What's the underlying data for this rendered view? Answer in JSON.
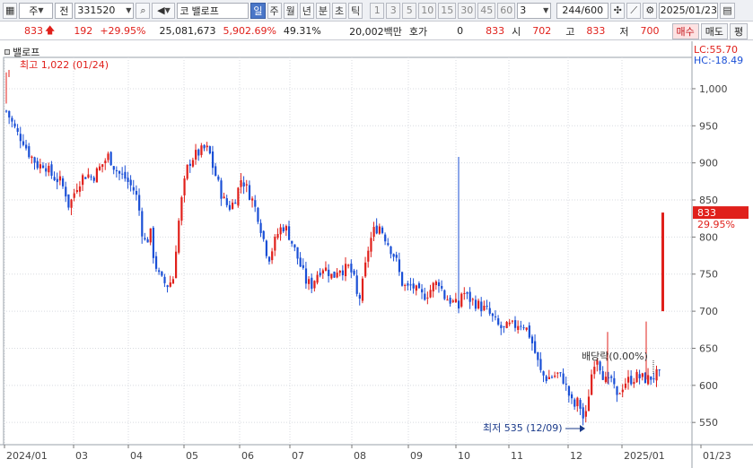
{
  "toolbar": {
    "market_label": "주",
    "type_label": "전",
    "code": "331520",
    "name": "밸로프",
    "name_prefix": "코",
    "periods": [
      "일",
      "주",
      "월",
      "년",
      "분",
      "초",
      "틱"
    ],
    "active_period": "일",
    "intervals": [
      "1",
      "3",
      "5",
      "10",
      "15",
      "30",
      "45",
      "60"
    ],
    "interval_value": "3",
    "count": "244",
    "count_total": "/600",
    "date": "2025/01/23"
  },
  "quote": {
    "price": "833",
    "change": "192",
    "change_pct": "+29.95%",
    "volume": "25,081,673",
    "volume_pct": "5,902.69%",
    "turnover_pct": "49.31%",
    "amount": "20,002백만",
    "hoga_label": "호가",
    "hoga_value": "0",
    "current": "833",
    "open_label": "시",
    "open": "702",
    "high_label": "고",
    "high": "833",
    "low_label": "저",
    "low": "700",
    "buy_label": "매수",
    "sell_label": "매도",
    "eval_label": "평"
  },
  "legend": {
    "name": "밸로프",
    "lc": "LC:55.70",
    "hc": "HC:-18.49"
  },
  "colors": {
    "up": "#e0201b",
    "down": "#1a4fd6",
    "price_tag": "#e0201b"
  },
  "chart_data": {
    "type": "candlestick",
    "ylim": [
      520,
      1035
    ],
    "yticks": [
      "1,000",
      "950",
      "900",
      "850",
      "800",
      "750",
      "700",
      "650",
      "600",
      "550"
    ],
    "ytick_values": [
      1000,
      950,
      900,
      850,
      800,
      750,
      700,
      650,
      600,
      550
    ],
    "xticks": [
      "2024/01",
      "03",
      "04",
      "05",
      "06",
      "07",
      "08",
      "09",
      "10",
      "11",
      "12",
      "2025/01",
      "01/23"
    ],
    "high_annotation": "최고 1,022 (01/24)",
    "low_annotation": "최저 535 (12/09)",
    "event_annotation": "배당락(0.00%)",
    "last_price_label": "833",
    "last_change_label": "29.95%",
    "last_price": 833,
    "path": [
      [
        0,
        1000
      ],
      [
        6,
        970
      ],
      [
        12,
        955
      ],
      [
        18,
        940
      ],
      [
        25,
        930
      ],
      [
        30,
        915
      ],
      [
        36,
        905
      ],
      [
        42,
        895
      ],
      [
        48,
        900
      ],
      [
        55,
        885
      ],
      [
        60,
        880
      ],
      [
        66,
        875
      ],
      [
        72,
        860
      ],
      [
        76,
        840
      ],
      [
        80,
        855
      ],
      [
        85,
        870
      ],
      [
        90,
        880
      ],
      [
        96,
        885
      ],
      [
        102,
        880
      ],
      [
        108,
        890
      ],
      [
        114,
        900
      ],
      [
        120,
        910
      ],
      [
        126,
        895
      ],
      [
        132,
        885
      ],
      [
        138,
        880
      ],
      [
        144,
        870
      ],
      [
        150,
        860
      ],
      [
        155,
        830
      ],
      [
        158,
        800
      ],
      [
        162,
        790
      ],
      [
        166,
        810
      ],
      [
        170,
        775
      ],
      [
        175,
        750
      ],
      [
        180,
        740
      ],
      [
        186,
        735
      ],
      [
        192,
        745
      ],
      [
        196,
        800
      ],
      [
        200,
        840
      ],
      [
        204,
        870
      ],
      [
        208,
        895
      ],
      [
        212,
        905
      ],
      [
        216,
        910
      ],
      [
        222,
        915
      ],
      [
        228,
        920
      ],
      [
        232,
        915
      ],
      [
        236,
        895
      ],
      [
        240,
        880
      ],
      [
        245,
        860
      ],
      [
        250,
        845
      ],
      [
        256,
        840
      ],
      [
        262,
        855
      ],
      [
        268,
        880
      ],
      [
        274,
        865
      ],
      [
        280,
        850
      ],
      [
        286,
        830
      ],
      [
        292,
        800
      ],
      [
        298,
        770
      ],
      [
        304,
        790
      ],
      [
        310,
        810
      ],
      [
        316,
        815
      ],
      [
        322,
        800
      ],
      [
        328,
        780
      ],
      [
        334,
        760
      ],
      [
        340,
        740
      ],
      [
        346,
        735
      ],
      [
        352,
        750
      ],
      [
        358,
        760
      ],
      [
        364,
        755
      ],
      [
        370,
        745
      ],
      [
        376,
        760
      ],
      [
        382,
        755
      ],
      [
        388,
        760
      ],
      [
        394,
        740
      ],
      [
        398,
        710
      ],
      [
        402,
        730
      ],
      [
        406,
        760
      ],
      [
        410,
        790
      ],
      [
        416,
        810
      ],
      [
        422,
        815
      ],
      [
        428,
        800
      ],
      [
        434,
        785
      ],
      [
        440,
        770
      ],
      [
        446,
        740
      ],
      [
        452,
        730
      ],
      [
        458,
        735
      ],
      [
        464,
        725
      ],
      [
        470,
        720
      ],
      [
        476,
        725
      ],
      [
        482,
        735
      ],
      [
        488,
        740
      ],
      [
        494,
        720
      ],
      [
        500,
        715
      ],
      [
        506,
        710
      ],
      [
        510,
        705
      ],
      [
        514,
        730
      ],
      [
        518,
        720
      ],
      [
        524,
        715
      ],
      [
        530,
        710
      ],
      [
        536,
        705
      ],
      [
        542,
        700
      ],
      [
        548,
        690
      ],
      [
        554,
        680
      ],
      [
        560,
        675
      ],
      [
        566,
        680
      ],
      [
        572,
        680
      ],
      [
        578,
        685
      ],
      [
        584,
        680
      ],
      [
        590,
        665
      ],
      [
        596,
        640
      ],
      [
        602,
        615
      ],
      [
        608,
        610
      ],
      [
        614,
        612
      ],
      [
        620,
        615
      ],
      [
        626,
        610
      ],
      [
        632,
        590
      ],
      [
        638,
        570
      ],
      [
        644,
        580
      ],
      [
        648,
        555
      ],
      [
        652,
        560
      ],
      [
        656,
        600
      ],
      [
        660,
        630
      ],
      [
        664,
        640
      ],
      [
        668,
        625
      ],
      [
        672,
        610
      ],
      [
        676,
        600
      ],
      [
        680,
        610
      ],
      [
        686,
        580
      ],
      [
        690,
        595
      ],
      [
        696,
        605
      ],
      [
        702,
        608
      ],
      [
        708,
        612
      ],
      [
        714,
        610
      ],
      [
        720,
        608
      ],
      [
        726,
        612
      ],
      [
        732,
        615
      ],
      [
        736,
        610
      ],
      [
        738,
        833
      ]
    ],
    "spikes": [
      [
        511,
        908
      ],
      [
        677,
        672
      ],
      [
        720,
        686
      ]
    ]
  }
}
